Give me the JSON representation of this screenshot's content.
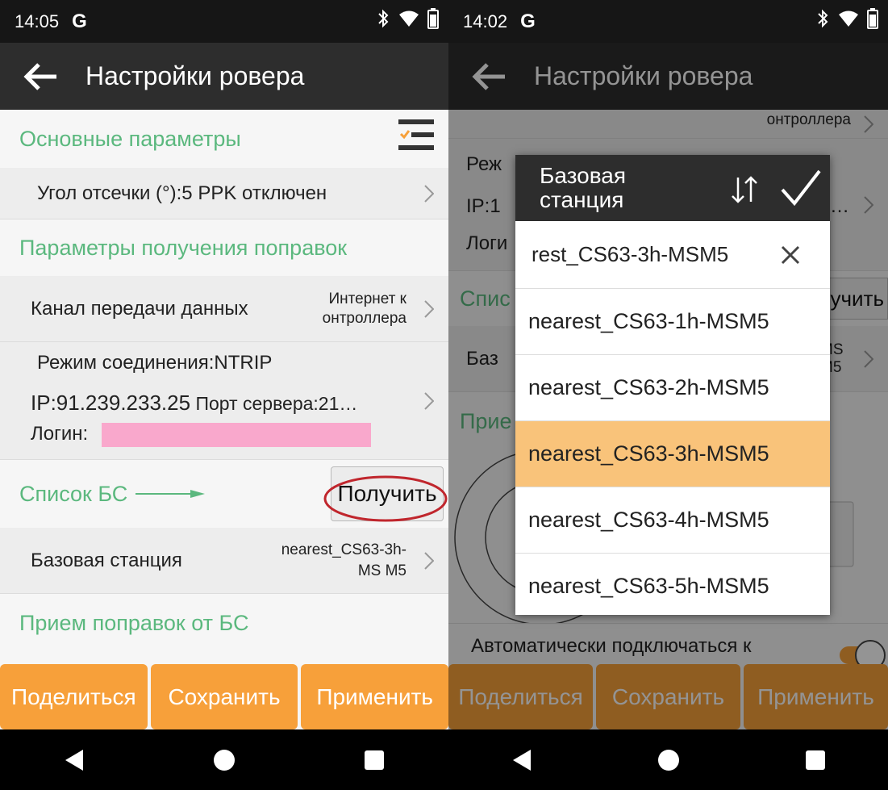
{
  "left": {
    "status": {
      "time": "14:05",
      "g": "G"
    },
    "appbar": {
      "title": "Настройки ровера"
    },
    "sections": {
      "basic": "Основные параметры",
      "corrections": "Параметры получения поправок",
      "bs_list": "Список БС",
      "receive": "Прием поправок от БС"
    },
    "rows": {
      "cutoff": "Угол отсечки (°):5 PPK отключен",
      "channel_label": "Канал передачи данных",
      "channel_value": "Интернет к онтроллера",
      "conn_mode": "Режим соединения:NTRIP",
      "ip_line_ip": "IP:91.239.233.25",
      "ip_line_port": " Порт сервера:21…",
      "login": "Логин:",
      "base_label": "Базовая станция",
      "base_value": "nearest_CS63-3h-MS M5"
    },
    "get_button": "Получить",
    "bottom": [
      "Поделиться",
      "Сохранить",
      "Применить"
    ]
  },
  "right": {
    "status": {
      "time": "14:02",
      "g": "G"
    },
    "appbar": {
      "title": "Настройки ровера"
    },
    "bg": {
      "channel_value": "онтроллера",
      "mode_prefix": "Реж",
      "ip_prefix": "IP:1",
      "ip_suffix": "1…",
      "login_prefix": "Логи",
      "list_prefix": "Спис",
      "get_suffix": "учить",
      "base_prefix": "Баз",
      "base_suffix": "MS M5",
      "receive_prefix": "Прие",
      "auto_connect": "Автоматически подключаться к"
    },
    "dialog": {
      "title": "Базовая станция",
      "search_value": "rest_CS63-3h-MSM5",
      "items": [
        "nearest_CS63-1h-MSM5",
        "nearest_CS63-2h-MSM5",
        "nearest_CS63-3h-MSM5",
        "nearest_CS63-4h-MSM5",
        "nearest_CS63-5h-MSM5"
      ],
      "selected_index": 2
    },
    "bottom": [
      "Поделиться",
      "Сохранить",
      "Применить"
    ]
  },
  "colors": {
    "accent_green": "#5bb87e",
    "button_orange": "#f7a03a",
    "selected_item": "#f9c37a",
    "appbar": "#2d2d2d",
    "annotation_red": "#c0262d",
    "redaction_pink": "#f9a8cc"
  }
}
